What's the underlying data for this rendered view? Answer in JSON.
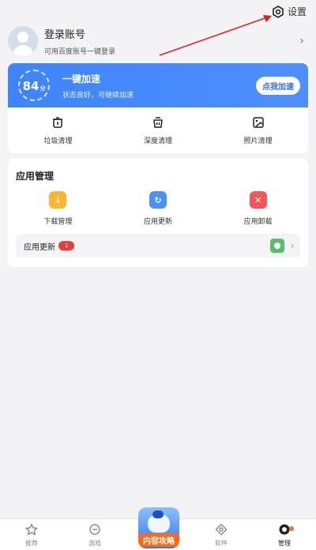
{
  "header": {
    "settings_label": "设置"
  },
  "account": {
    "name": "登录账号",
    "subtitle": "可用百度账号一键登录"
  },
  "speed": {
    "score": "84",
    "score_unit": "分",
    "title": "一键加速",
    "subtitle": "状态良好，可继续加速",
    "button": "点我加速"
  },
  "clean": [
    {
      "label": "垃圾清理",
      "icon": "trash-bin-icon"
    },
    {
      "label": "深度清理",
      "icon": "deep-clean-icon"
    },
    {
      "label": "照片清理",
      "icon": "photo-clean-icon"
    }
  ],
  "apps": {
    "title": "应用管理",
    "items": [
      {
        "label": "下载管理",
        "icon": "download-icon",
        "color": "#f7b733"
      },
      {
        "label": "应用更新",
        "icon": "update-icon",
        "color": "#4a90f5"
      },
      {
        "label": "应用卸载",
        "icon": "uninstall-icon",
        "color": "#f25757"
      }
    ],
    "update_row": {
      "label": "应用更新",
      "badge": "1"
    }
  },
  "nav": {
    "items": [
      {
        "label": "推荐",
        "icon": "star-icon"
      },
      {
        "label": "游戏",
        "icon": "gamepad-icon"
      },
      {
        "label": "软件",
        "icon": "software-icon"
      },
      {
        "label": "管理",
        "icon": "manage-icon"
      }
    ],
    "center_label": "内容攻略",
    "active": "管理"
  },
  "colors": {
    "accent": "#3e84fb",
    "badge": "#ee3b3b",
    "nav_dot": "#ff6d2e",
    "arrow": "#e02020"
  }
}
